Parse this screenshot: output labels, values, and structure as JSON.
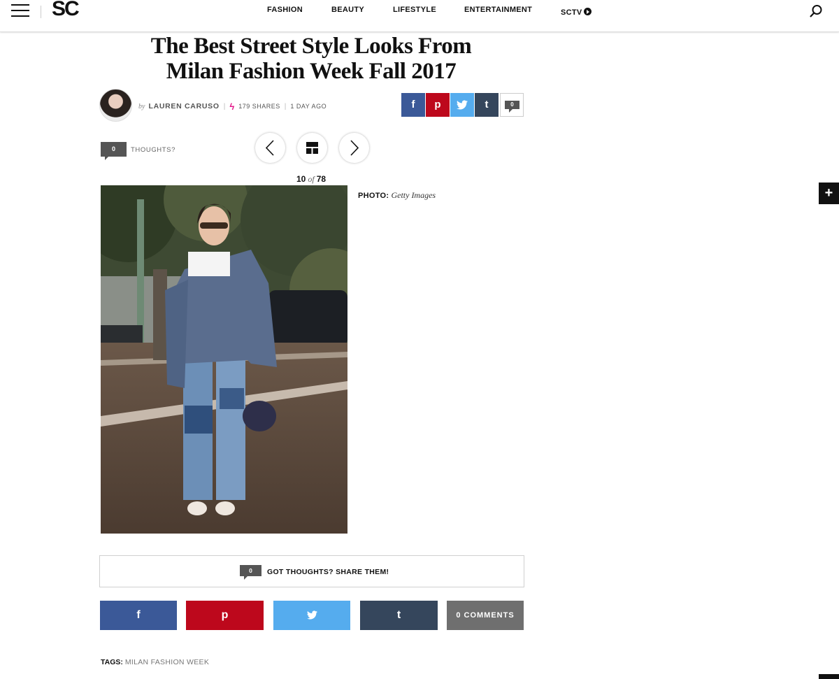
{
  "header": {
    "logo": "SC",
    "nav": [
      "FASHION",
      "BEAUTY",
      "LIFESTYLE",
      "ENTERTAINMENT",
      "SCTV"
    ],
    "menu_icon": "hamburger-menu-icon",
    "search_icon": "search-icon"
  },
  "article": {
    "title_line1": "The Best Street Style Looks From",
    "title_line2": "Milan Fashion Week Fall 2017",
    "byline_prefix": "by",
    "author": "LAUREN CARUSO",
    "shares": "179 SHARES",
    "posted": "1 DAY AGO"
  },
  "share_top": {
    "facebook": "f",
    "pinterest": "p",
    "twitter": "t",
    "tumblr": "t",
    "comment_count": "0"
  },
  "gallery": {
    "thoughts_count": "0",
    "thoughts_label": "THOUGHTS?",
    "current": "10",
    "of_label": "of",
    "total": "78",
    "photo_credit_label": "PHOTO:",
    "photo_credit": "Getty Images"
  },
  "comments_bar": {
    "count": "0",
    "label": "GOT THOUGHTS? SHARE THEM!"
  },
  "share_bottom": {
    "facebook": "f",
    "pinterest": "p",
    "twitter": "t",
    "tumblr": "t",
    "comments": "0 COMMENTS"
  },
  "tags": {
    "label": "TAGS:",
    "items": [
      "MILAN FASHION WEEK"
    ]
  },
  "side_tab": {
    "label": "+"
  },
  "colors": {
    "facebook": "#3b5998",
    "pinterest": "#bd081c",
    "twitter": "#55acee",
    "tumblr": "#35465c",
    "accent_bolt": "#e3188a",
    "comments_gray": "#6f6f6f"
  }
}
